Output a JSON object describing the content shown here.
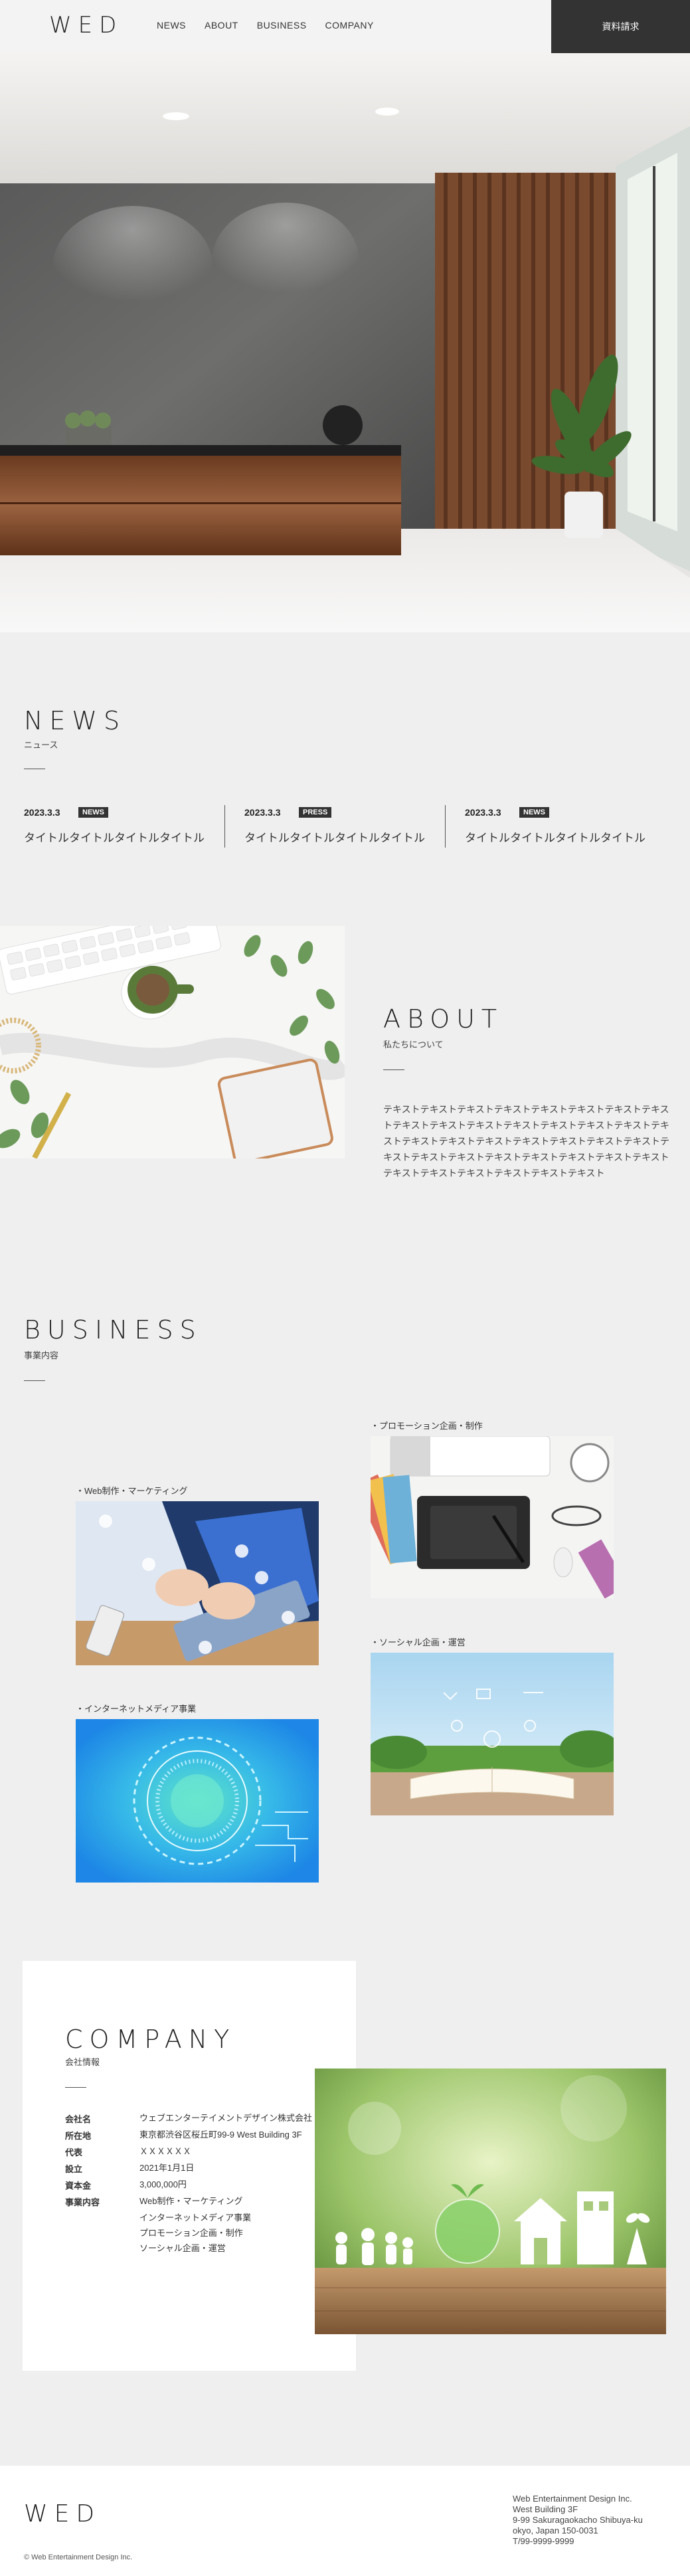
{
  "header": {
    "logo": "WED",
    "nav": [
      "NEWS",
      "ABOUT",
      "BUSINESS",
      "COMPANY"
    ],
    "cta": "資料請求"
  },
  "news": {
    "title": "NEWS",
    "subtitle": "ニュース",
    "items": [
      {
        "date": "2023.3.3",
        "tag": "NEWS",
        "title": "タイトルタイトルタイトルタイトル"
      },
      {
        "date": "2023.3.3",
        "tag": "PRESS",
        "title": "タイトルタイトルタイトルタイトル"
      },
      {
        "date": "2023.3.3",
        "tag": "NEWS",
        "title": "タイトルタイトルタイトルタイトル"
      }
    ]
  },
  "about": {
    "title": "ABOUT",
    "subtitle": "私たちについて",
    "body": "テキストテキストテキストテキストテキストテキストテキストテキストテキストテキストテキストテキストテキストテキストテキストテキストテキストテキストテキストテキストテキストテキストテキストテキストテキストテキストテキストテキストテキストテキストテキストテキストテキストテキストテキストテキストテキスト"
  },
  "business": {
    "title": "BUSINESS",
    "subtitle": "事業内容",
    "items": [
      {
        "label": "・Web制作・マーケティング"
      },
      {
        "label": "・プロモーション企画・制作"
      },
      {
        "label": "・インターネットメディア事業"
      },
      {
        "label": "・ソーシャル企画・運営"
      }
    ]
  },
  "company": {
    "title": "COMPANY",
    "subtitle": "会社情報",
    "rows": [
      {
        "key": "会社名",
        "value": "ウェブエンターテイメントデザイン株式会社"
      },
      {
        "key": "所在地",
        "value": "東京都渋谷区桜丘町99-9 West Building 3F"
      },
      {
        "key": "代表",
        "value": "ＸＸＸＸＸＸ"
      },
      {
        "key": "設立",
        "value": "2021年1月1日"
      },
      {
        "key": "資本金",
        "value": "3,000,000円"
      },
      {
        "key": "事業内容",
        "value": "Web制作・マーケティング"
      },
      {
        "key": "",
        "value": "インターネットメディア事業"
      },
      {
        "key": "",
        "value": "プロモーション企画・制作"
      },
      {
        "key": "",
        "value": "ソーシャル企画・運営"
      }
    ]
  },
  "footer": {
    "logo": "WED",
    "copyright": "© Web Entertainment Design Inc.",
    "address_lines": [
      "Web Entertainment Design Inc.",
      "West Building 3F",
      "9-99 Sakuragaokacho Shibuya-ku",
      "okyo, Japan 150-0031",
      "T/99-9999-9999"
    ]
  },
  "colors": {
    "background": "#efefef",
    "dark": "#333333",
    "white": "#ffffff"
  }
}
